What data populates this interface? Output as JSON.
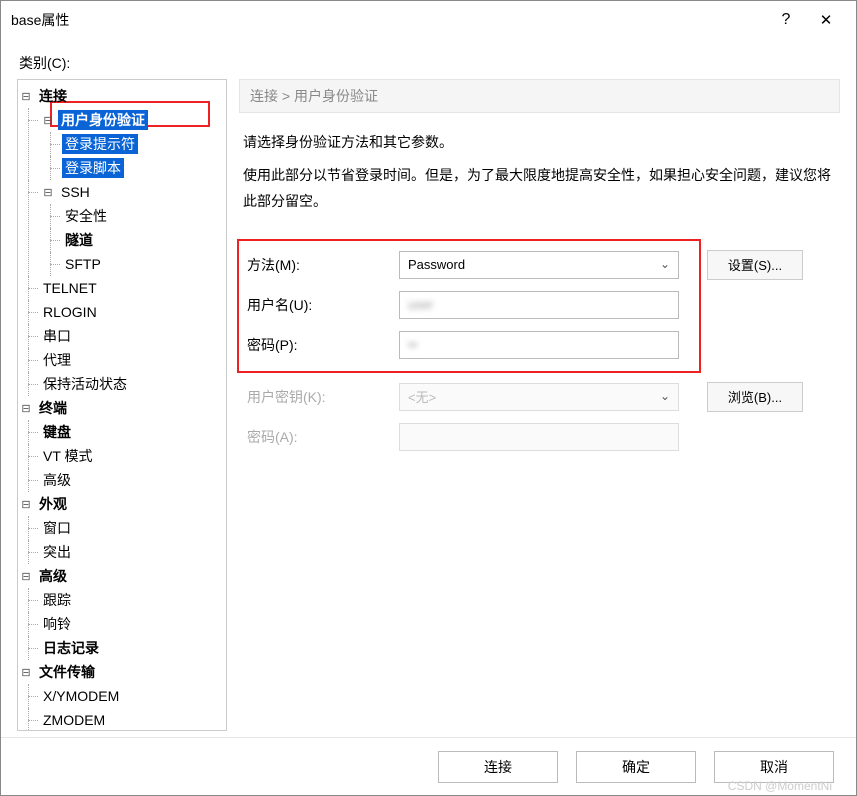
{
  "window": {
    "title": "base属性"
  },
  "sidebar": {
    "category_label": "类别(C):",
    "tree": {
      "connection": {
        "label": "连接",
        "auth": "用户身份验证",
        "login_prompt": "登录提示符",
        "login_script": "登录脚本",
        "ssh": {
          "label": "SSH",
          "security": "安全性",
          "tunnel": "隧道",
          "sftp": "SFTP"
        },
        "telnet": "TELNET",
        "rlogin": "RLOGIN",
        "serial": "串口",
        "proxy": "代理",
        "keepalive": "保持活动状态"
      },
      "terminal": {
        "label": "终端",
        "keyboard": "键盘",
        "vt": "VT 模式",
        "advanced": "高级"
      },
      "appearance": {
        "label": "外观",
        "window": "窗口",
        "highlight": "突出"
      },
      "advanced": {
        "label": "高级",
        "trace": "跟踪",
        "bell": "响铃",
        "log": "日志记录"
      },
      "file_transfer": {
        "label": "文件传输",
        "xy": "X/YMODEM",
        "z": "ZMODEM"
      }
    }
  },
  "main": {
    "breadcrumb": "连接  >  用户身份验证",
    "desc1": "请选择身份验证方法和其它参数。",
    "desc2": "使用此部分以节省登录时间。但是，为了最大限度地提高安全性，如果担心安全问题，建议您将此部分留空。",
    "form": {
      "method_label": "方法(M):",
      "method_value": "Password",
      "user_label": "用户名(U):",
      "user_value": "user",
      "pass_label": "密码(P):",
      "pass_value": "••",
      "key_label": "用户密钥(K):",
      "key_value": "<无>",
      "passphrase_label": "密码(A):",
      "setup_btn": "设置(S)...",
      "browse_btn": "浏览(B)..."
    }
  },
  "footer": {
    "connect": "连接",
    "ok": "确定",
    "cancel": "取消",
    "watermark": "CSDN @MomentNi"
  }
}
